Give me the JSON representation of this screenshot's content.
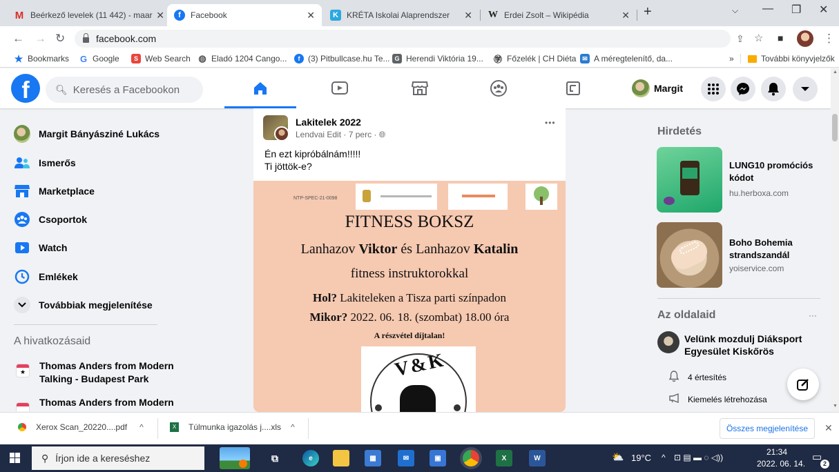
{
  "browser": {
    "tabs": [
      {
        "title": "Beérkező levelek (11 442) - maar",
        "icon": "gmail-icon",
        "active": false
      },
      {
        "title": "Facebook",
        "icon": "facebook-icon",
        "active": true
      },
      {
        "title": "KRÉTA Iskolai Alaprendszer",
        "icon": "kreta-icon",
        "active": false
      },
      {
        "title": "Erdei Zsolt – Wikipédia",
        "icon": "wikipedia-icon",
        "active": false
      }
    ],
    "url": "facebook.com",
    "bookmarks": [
      {
        "label": "Bookmarks",
        "icon": "star-icon"
      },
      {
        "label": "Google",
        "icon": "google-icon"
      },
      {
        "label": "Web Search",
        "icon": "websearch-icon"
      },
      {
        "label": "Eladó 1204 Cango...",
        "icon": "globe-icon"
      },
      {
        "label": "(3) Pitbullcase.hu Te...",
        "icon": "facebook-icon"
      },
      {
        "label": "Herendi Viktória 19...",
        "icon": "page-icon"
      },
      {
        "label": "Főzelék | CH Diéta",
        "icon": "chef-icon"
      },
      {
        "label": "A méregtelenítő, da...",
        "icon": "email-icon"
      }
    ],
    "more_bookmarks": "»",
    "other_bookmarks": "További könyvjelzők"
  },
  "fb": {
    "search_placeholder": "Keresés a Facebookon",
    "profile_name": "Margit"
  },
  "leftnav": {
    "profile": "Margit Bányásziné Lukács",
    "items": [
      {
        "label": "Ismerős"
      },
      {
        "label": "Marketplace"
      },
      {
        "label": "Csoportok"
      },
      {
        "label": "Watch"
      },
      {
        "label": "Emlékek"
      },
      {
        "label": "Továbbiak megjelenítése"
      }
    ],
    "shortcuts_title": "A hivatkozásaid",
    "shortcuts": [
      {
        "line1": "Thomas Anders from Modern",
        "line2": "Talking - Budapest Park"
      },
      {
        "line1": "Thomas Anders from Modern",
        "line2": ""
      }
    ]
  },
  "post": {
    "group": "Lakitelek 2022",
    "author": "Lendvai Edit",
    "time": "7 perc",
    "separator": "·",
    "more": "•••",
    "text_line1": "Én ezt kipróbálnám!!!!!",
    "text_line2": "Ti jöttök-e?",
    "image": {
      "code": "NTP-SPEC-21-0098",
      "title": "FITNESS BOKSZ",
      "line_pre1": "Lanhazov ",
      "name1": "Viktor",
      "line_mid": " és Lanhazov ",
      "name2": "Katalin",
      "line3": "fitness instruktorokkal",
      "where_label": "Hol?",
      "where": " Lakiteleken a Tisza parti színpadon",
      "when_label": "Mikor?",
      "when": "  2022. 06. 18. (szombat) 18.00 óra",
      "free": "A részvétel díjtalan!",
      "logo": "V & K"
    }
  },
  "right": {
    "ads_title": "Hirdetés",
    "ads": [
      {
        "title": "LUNG10 promóciós kódot",
        "domain": "hu.herboxa.com"
      },
      {
        "title": "Boho Bohemia strandszandál",
        "domain": "yoiservice.com"
      }
    ],
    "pages_title": "Az oldalaid",
    "pages_more": "···",
    "page_name": "Velünk mozdulj Diáksport Egyesület Kiskőrös",
    "notifications": "4 értesítés",
    "promote": "Kiemelés létrehozása"
  },
  "downloads": {
    "items": [
      {
        "name": "Xerox Scan_20220....pdf"
      },
      {
        "name": "Túlmunka igazolás j....xls"
      }
    ],
    "show_all": "Összes megjelenítése"
  },
  "taskbar": {
    "search_placeholder": "Írjon ide a kereséshez",
    "weather": "19°C",
    "time": "21:34",
    "date": "2022. 06. 14.",
    "notif_count": "2"
  },
  "colors": {
    "fb_blue": "#1877f2",
    "post_image_bg": "#f6c9b1",
    "taskbar": "#1f2a44"
  }
}
